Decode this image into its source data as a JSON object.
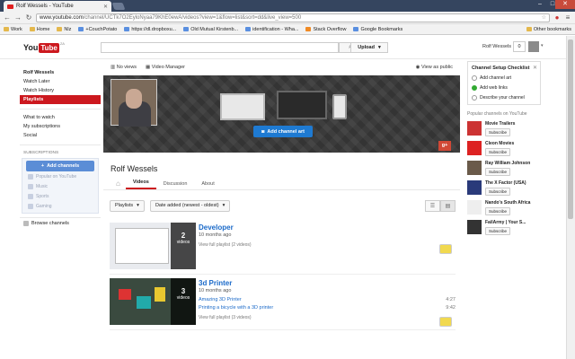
{
  "browser": {
    "tab_title": "Rolf Wessels - YouTube",
    "url_host": "www.youtube.com",
    "url_path": "/channel/UCTk7O2EyloNyaa79KhE0ewA/videos?view=1&flow=list&sort=dd&live_view=500",
    "bookmarks": [
      "Work",
      "Home",
      "Nlz",
      "+CouchPotato",
      "https://dl.dropboxu...",
      "Old Mutual Kirstenb...",
      "identification - Wha...",
      "Stack Overflow",
      "Google Bookmarks"
    ],
    "other_bookmarks": "Other bookmarks"
  },
  "header": {
    "logo_you": "You",
    "logo_tube": "Tube",
    "logo_region": "ZA",
    "upload_label": "Upload",
    "username": "Rolf Wessels",
    "notifications": "0"
  },
  "leftnav": {
    "items": [
      "Rolf Wessels",
      "Watch Later",
      "Watch History",
      "Playlists"
    ],
    "items2": [
      "What to watch",
      "My subscriptions",
      "Social"
    ],
    "subscriptions_header": "SUBSCRIPTIONS",
    "add_channels": "Add channels",
    "sub_items": [
      "Popular on YouTube",
      "Music",
      "Sports",
      "Gaming"
    ],
    "browse_channels": "Browse channels"
  },
  "channel": {
    "no_views": "No views",
    "video_manager": "Video Manager",
    "view_as_public": "View as public",
    "add_channel_art": "Add channel art",
    "title": "Rolf Wessels",
    "tabs": [
      "Videos",
      "Discussion",
      "About"
    ],
    "filter_playlists": "Playlists",
    "sort": "Date added (newest - oldest)"
  },
  "playlists": [
    {
      "title": "Developer",
      "count": "2",
      "count_label": "videos",
      "age": "10 months ago",
      "view_full": "View full playlist (2 videos)"
    },
    {
      "title": "3d Printer",
      "count": "3",
      "count_label": "videos",
      "age": "10 months ago",
      "videos": [
        {
          "title": "Amazing 3D Printer",
          "duration": "4:27"
        },
        {
          "title": "Printing a bicycle with a 3D printer",
          "duration": "9:42"
        }
      ],
      "view_full": "View full playlist (3 videos)"
    }
  ],
  "checklist": {
    "title": "Channel Setup Checklist",
    "items": [
      {
        "label": "Add channel art",
        "done": false
      },
      {
        "label": "Add web links",
        "done": true
      },
      {
        "label": "Describe your channel",
        "done": false
      }
    ]
  },
  "popular": {
    "header": "Popular channels on YouTube",
    "subscribe": "Subscribe",
    "channels": [
      "Movie Trailers",
      "Cleon Movies",
      "Ray William Johnson",
      "The X Factor (USA)",
      "Nando's South Africa",
      "FailArmy | Your S..."
    ]
  }
}
